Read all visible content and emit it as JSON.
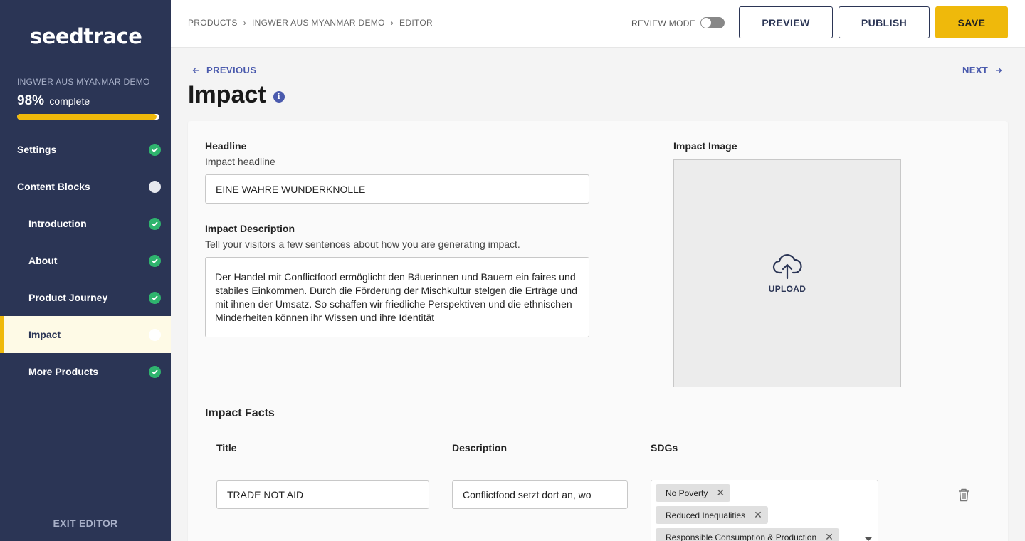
{
  "app": {
    "logo": "seedtrace"
  },
  "sidebar": {
    "project_name": "INGWER AUS MYANMAR DEMO",
    "percent": "98%",
    "percent_label": "complete",
    "progress": 0.98,
    "items": [
      {
        "label": "Settings",
        "status": "complete"
      },
      {
        "label": "Content Blocks",
        "status": "incomplete"
      },
      {
        "label": "Introduction",
        "status": "complete"
      },
      {
        "label": "About",
        "status": "complete"
      },
      {
        "label": "Product Journey",
        "status": "complete"
      },
      {
        "label": "Impact",
        "status": "incomplete",
        "active": true
      },
      {
        "label": "More Products",
        "status": "complete"
      }
    ],
    "exit_label": "EXIT EDITOR"
  },
  "header": {
    "breadcrumb": [
      "PRODUCTS",
      "INGWER AUS MYANMAR DEMO",
      "EDITOR"
    ],
    "breadcrumb_sep": "›",
    "review_mode_label": "REVIEW MODE",
    "review_mode_on": false,
    "preview_label": "PREVIEW",
    "publish_label": "PUBLISH",
    "save_label": "SAVE"
  },
  "nav": {
    "previous_label": "PREVIOUS",
    "next_label": "NEXT"
  },
  "page": {
    "title": "Impact"
  },
  "form": {
    "headline_label": "Headline",
    "headline_sublabel": "Impact headline",
    "headline_value": "EINE WAHRE WUNDERKNOLLE",
    "description_label": "Impact Description",
    "description_sublabel": "Tell your visitors a few sentences about how you are generating impact.",
    "description_value": "Der Handel mit Conflictfood ermöglicht den Bäuerinnen und Bauern ein faires und stabiles Einkommen. Durch die Förderung der Mischkultur stelgen die Erträge und mit ihnen der Umsatz. So schaffen wir friedliche Perspektiven und die ethnischen Minderheiten können ihr Wissen und ihre Identität",
    "image_label": "Impact Image",
    "upload_label": "UPLOAD"
  },
  "facts": {
    "title": "Impact Facts",
    "columns": [
      "Title",
      "Description",
      "SDGs"
    ],
    "rows": [
      {
        "title": "TRADE NOT AID",
        "description": "Conflictfood setzt dort an, wo",
        "sdgs": [
          "No Poverty",
          "Reduced Inequalities",
          "Responsible Consumption & Production"
        ]
      }
    ]
  },
  "colors": {
    "sidebar_bg": "#2b3555",
    "accent": "#efb90b",
    "link": "#4a5aad",
    "success": "#2fb46e"
  }
}
